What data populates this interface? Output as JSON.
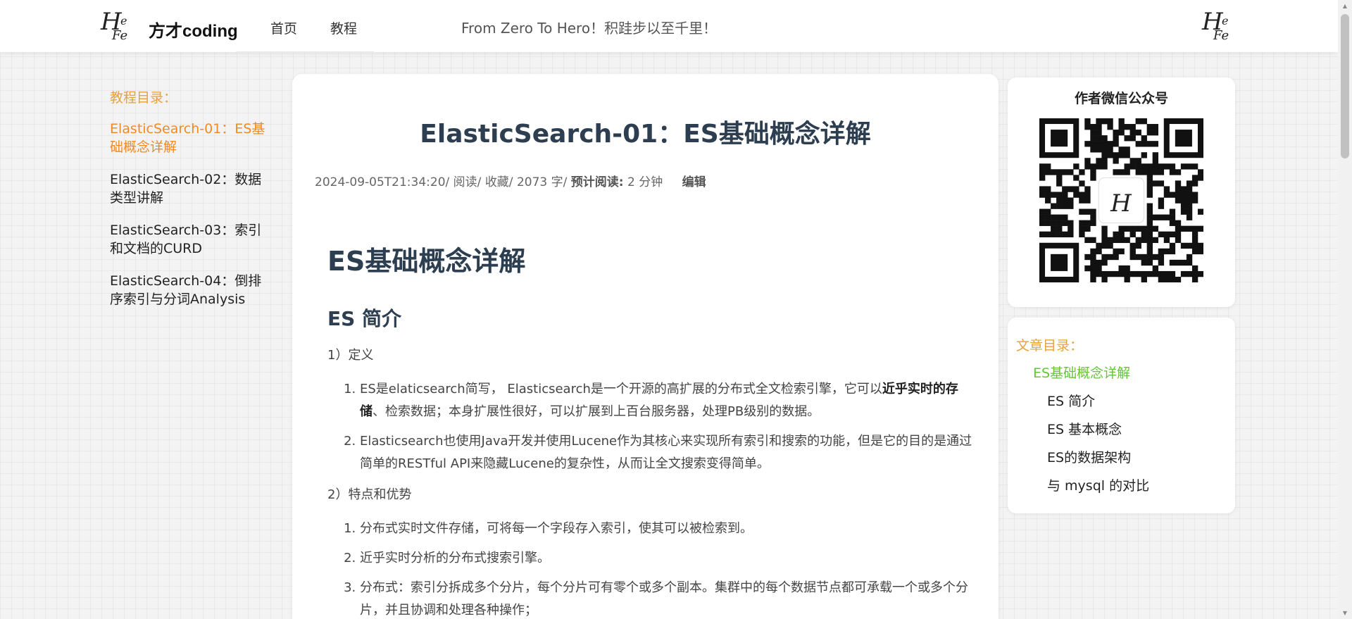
{
  "header": {
    "logo_left": {
      "h": "H",
      "e1": "e",
      "e2": "Fe"
    },
    "brand": "方才coding",
    "nav": [
      {
        "label": "首页"
      },
      {
        "label": "教程"
      }
    ],
    "slogan": "From Zero To Hero！积跬步以至千里！",
    "logo_right": {
      "h": "H",
      "e1": "e",
      "e2": "Fe"
    }
  },
  "directory": {
    "title": "教程目录：",
    "items": [
      {
        "label": "ElasticSearch-01：ES基础概念详解",
        "active": true
      },
      {
        "label": "ElasticSearch-02：数据类型讲解",
        "active": false
      },
      {
        "label": "ElasticSearch-03：索引和文档的CURD",
        "active": false
      },
      {
        "label": "ElasticSearch-04：倒排序索引与分词Analysis",
        "active": false
      }
    ]
  },
  "article": {
    "title": "ElasticSearch-01：ES基础概念详解",
    "meta": {
      "date": "2024-09-05T21:34:20/",
      "read": "阅读/",
      "fav": "收藏/",
      "words": "2073 字/",
      "est_label": "预计阅读:",
      "est_value": "2 分钟",
      "edit": "编辑"
    },
    "h1": "ES基础概念详解",
    "h2": "ES 简介",
    "sec1": "1）定义",
    "def_items": [
      {
        "pre": "ES是elaticsearch简写， Elasticsearch是一个开源的高扩展的分布式全文检索引擎，它可以",
        "bold": "近乎实时的存储",
        "post": "、检索数据；本身扩展性很好，可以扩展到上百台服务器，处理PB级别的数据。"
      },
      {
        "pre": "Elasticsearch也使用Java开发并使用Lucene作为其核心来实现所有索引和搜索的功能，但是它的目的是通过简单的RESTful API来隐藏Lucene的复杂性，从而让全文搜索变得简单。",
        "bold": "",
        "post": ""
      }
    ],
    "sec2": "2）特点和优势",
    "feat_items": [
      "分布式实时文件存储，可将每一个字段存入索引，使其可以被检索到。",
      "近乎实时分析的分布式搜索引擎。",
      "分布式：索引分拆成多个分片，每个分片可有零个或多个副本。集群中的每个数据节点都可承载一个或多个分片，并且协调和处理各种操作；"
    ]
  },
  "sidebar": {
    "qr_title": "作者微信公众号",
    "toc_title": "文章目录：",
    "toc": [
      {
        "label": "ES基础概念详解",
        "level": 1
      },
      {
        "label": "ES 简介",
        "level": 2
      },
      {
        "label": "ES 基本概念",
        "level": 2
      },
      {
        "label": "ES的数据架构",
        "level": 2
      },
      {
        "label": "与 mysql 的对比",
        "level": 2
      }
    ]
  },
  "colors": {
    "accent": "#e6a23c",
    "active_link": "#f08a24",
    "toc_active": "#67c23a",
    "heading": "#2c3e50"
  }
}
